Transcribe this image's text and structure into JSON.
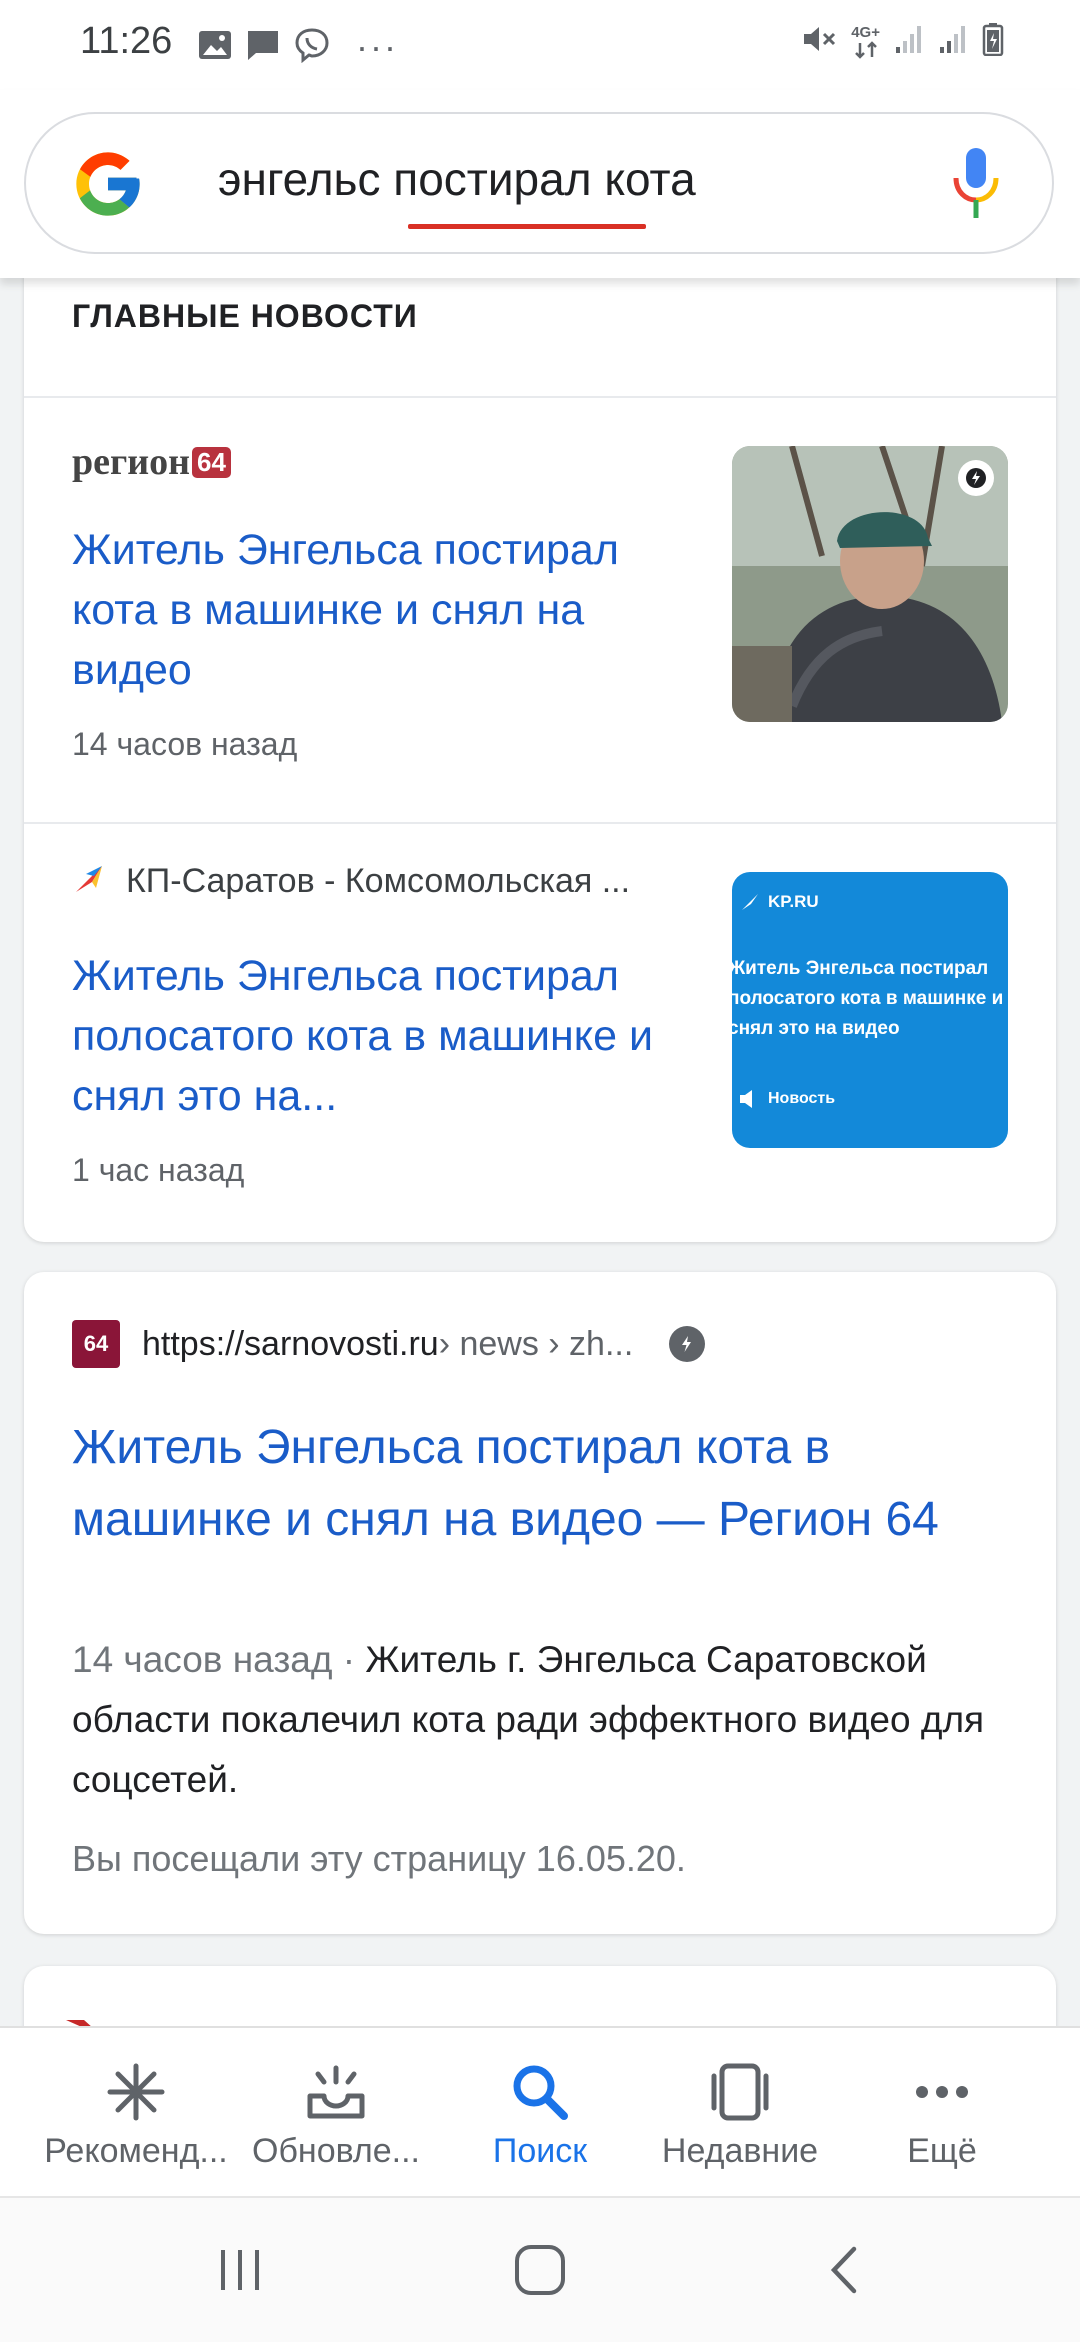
{
  "status_bar": {
    "time": "11:26",
    "left_icons": [
      "image-icon",
      "message-icon",
      "viber-icon"
    ],
    "overflow": "···",
    "right_icons": [
      "mute-icon",
      "network-4g-icon",
      "signal-icon",
      "signal-icon",
      "battery-icon"
    ],
    "network_label": "4G+"
  },
  "search": {
    "query": "энгельс постирал кота",
    "misspelled_word": "постирал"
  },
  "top_news": {
    "header": "ГЛАВНЫЕ НОВОСТИ",
    "items": [
      {
        "source_logo_text": "регион",
        "source_logo_badge": "64",
        "title": "Житель Энгельса постирал кота в машинке и снял на видео",
        "time": "14 часов назад",
        "thumb_kind": "photo",
        "amp": true
      },
      {
        "source": "КП-Саратов - Комсомольская ...",
        "title": "Житель Энгельса постирал полосатого кота в машинке и снял это на...",
        "time": "1 час назад",
        "thumb_brand": "KP.RU",
        "thumb_text": "Житель Энгельса постирал полосатого кота в машинке и снял это на видео",
        "thumb_tag": "Новость"
      }
    ]
  },
  "result": {
    "favicon_text": "64",
    "url": "https://sarnovosti.ru",
    "breadcrumb": " › news › zh...",
    "title": "Житель Энгельса постирал кота в машинке и снял на видео — Регион 64",
    "snippet_date": "14 часов назад · ",
    "snippet": "Житель г. Энгельса Саратовской области покалечил кота ради эффектного видео для соцсетей.",
    "visited": "Вы посещали эту страницу 16.05.20."
  },
  "bottom_nav": {
    "items": [
      {
        "label": "Рекоменд...",
        "icon": "asterisk-icon"
      },
      {
        "label": "Обновле...",
        "icon": "updates-icon"
      },
      {
        "label": "Поиск",
        "icon": "search-icon"
      },
      {
        "label": "Недавние",
        "icon": "recent-tabs-icon"
      },
      {
        "label": "Ещё",
        "icon": "more-icon"
      }
    ],
    "active_index": 2
  },
  "colors": {
    "link": "#1a5cc8",
    "active": "#1a73e8",
    "kp_blue": "#1389d9",
    "region_red": "#b8323e"
  }
}
